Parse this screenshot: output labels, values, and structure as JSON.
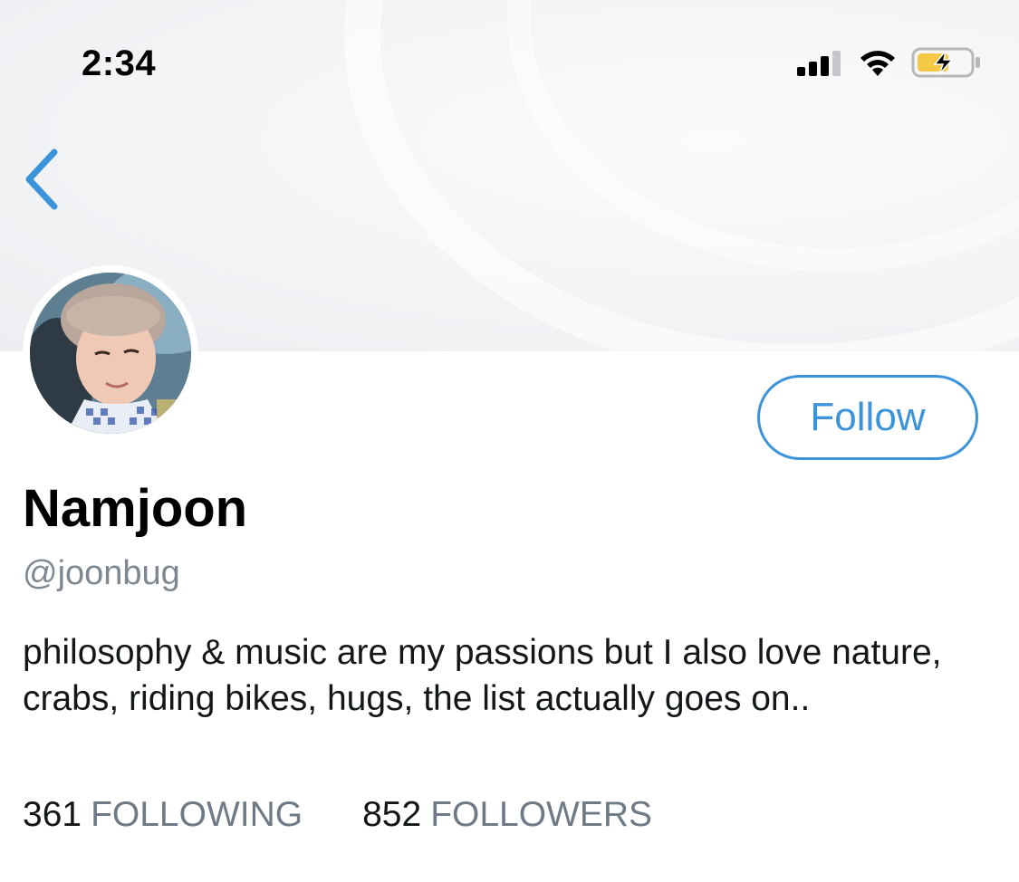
{
  "status_bar": {
    "time": "2:34",
    "signal_icon": "cellular-signal-icon",
    "wifi_icon": "wifi-icon",
    "battery_icon": "battery-charging-icon",
    "battery_color": "#f5c944"
  },
  "nav": {
    "back_icon": "chevron-left-icon",
    "accent": "#3b94d9"
  },
  "profile": {
    "display_name": "Namjoon",
    "handle": "@joonbug",
    "bio": "philosophy & music are my passions but I also love nature, crabs, riding bikes, hugs, the list actually goes on..",
    "follow_label": "Follow"
  },
  "stats": {
    "following_count": "361",
    "following_label": "FOLLOWING",
    "followers_count": "852",
    "followers_label": "FOLLOWERS"
  }
}
